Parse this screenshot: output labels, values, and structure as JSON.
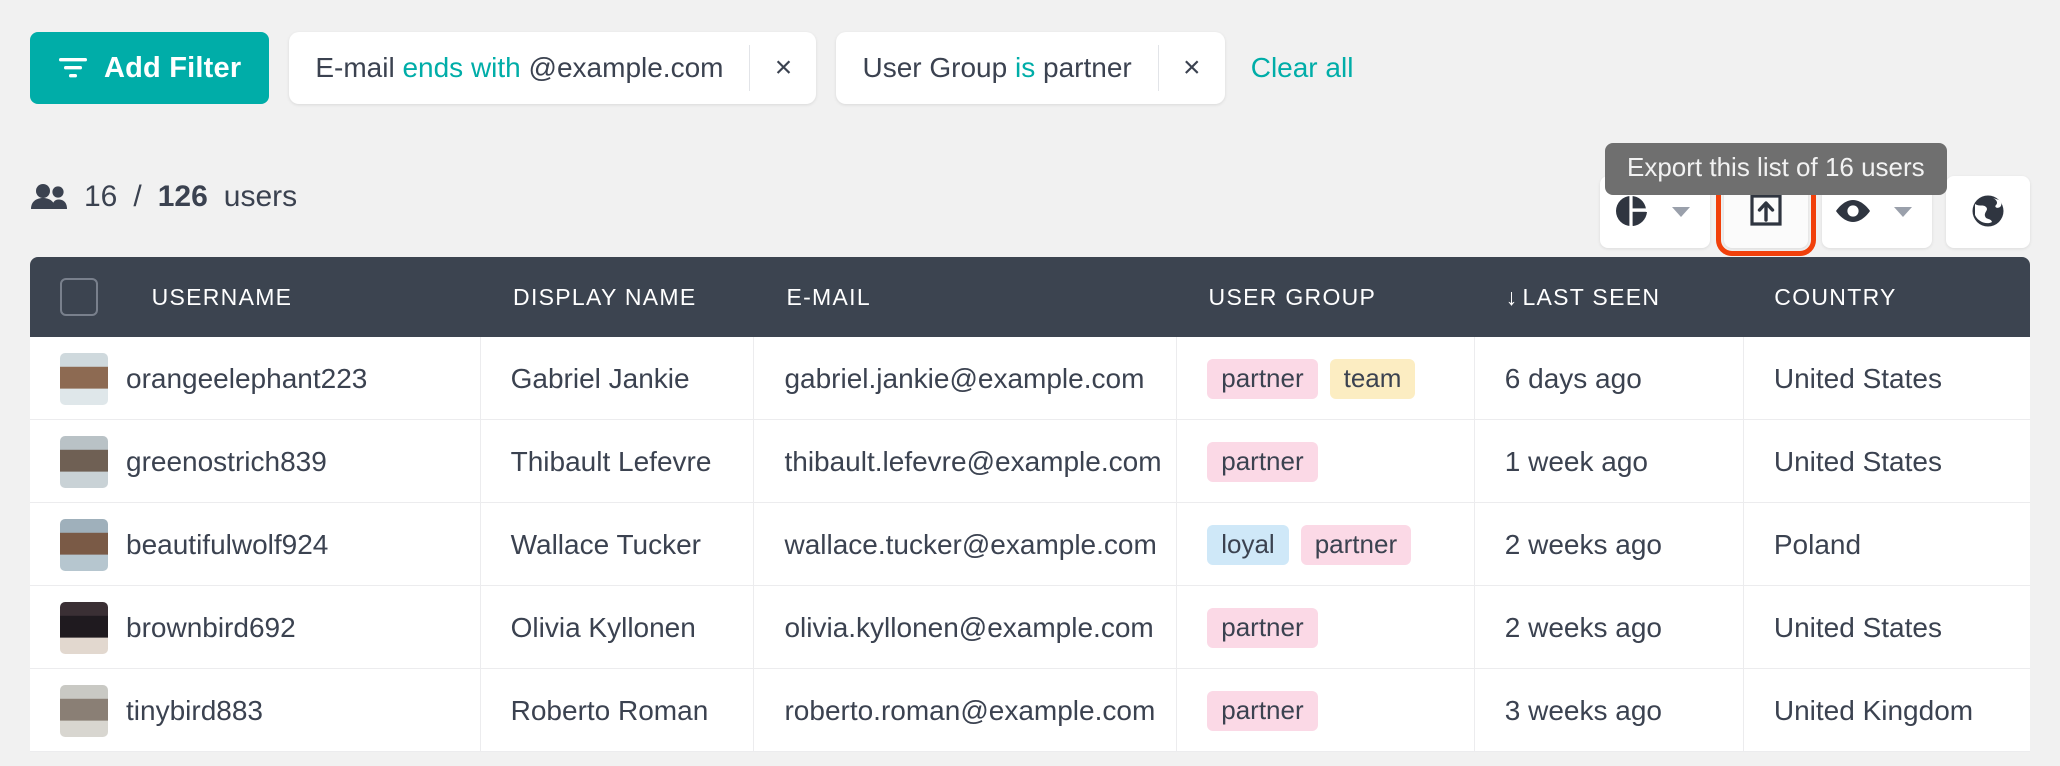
{
  "filter_bar": {
    "add_filter_label": "Add Filter",
    "clear_all_label": "Clear all",
    "close_glyph": "×",
    "chips": [
      {
        "field": "E-mail",
        "operator": "ends with",
        "value": "@example.com"
      },
      {
        "field": "User Group",
        "operator": "is",
        "value": "partner"
      }
    ]
  },
  "summary": {
    "shown": "16",
    "separator": "/",
    "total": "126",
    "unit": "users"
  },
  "toolbar": {
    "tooltip": "Export this list of 16 users",
    "buttons": [
      {
        "name": "chart-icon",
        "label": "Chart view",
        "has_caret": true
      },
      {
        "name": "export-icon",
        "label": "Export",
        "has_caret": false
      },
      {
        "name": "eye-icon",
        "label": "Visible columns",
        "has_caret": true
      },
      {
        "name": "globe-icon",
        "label": "Locale",
        "has_caret": false
      }
    ],
    "highlight_color": "#f1400b"
  },
  "table": {
    "columns": [
      {
        "key": "username",
        "label": "USERNAME",
        "sorted": false
      },
      {
        "key": "display_name",
        "label": "DISPLAY NAME",
        "sorted": false
      },
      {
        "key": "email",
        "label": "E-MAIL",
        "sorted": false
      },
      {
        "key": "user_group",
        "label": "USER GROUP",
        "sorted": false
      },
      {
        "key": "last_seen",
        "label": "LAST SEEN",
        "sorted": true,
        "sort_glyph": "↓"
      },
      {
        "key": "country",
        "label": "COUNTRY",
        "sorted": false
      }
    ],
    "rows": [
      {
        "username": "orangeelephant223",
        "display_name": "Gabriel Jankie",
        "email": "gabriel.jankie@example.com",
        "user_group": [
          "partner",
          "team"
        ],
        "last_seen": "6 days ago",
        "country": "United States"
      },
      {
        "username": "greenostrich839",
        "display_name": "Thibault Lefevre",
        "email": "thibault.lefevre@example.com",
        "user_group": [
          "partner"
        ],
        "last_seen": "1 week ago",
        "country": "United States"
      },
      {
        "username": "beautifulwolf924",
        "display_name": "Wallace Tucker",
        "email": "wallace.tucker@example.com",
        "user_group": [
          "loyal",
          "partner"
        ],
        "last_seen": "2 weeks ago",
        "country": "Poland"
      },
      {
        "username": "brownbird692",
        "display_name": "Olivia Kyllonen",
        "email": "olivia.kyllonen@example.com",
        "user_group": [
          "partner"
        ],
        "last_seen": "2 weeks ago",
        "country": "United States"
      },
      {
        "username": "tinybird883",
        "display_name": "Roberto Roman",
        "email": "roberto.roman@example.com",
        "user_group": [
          "partner"
        ],
        "last_seen": "3 weeks ago",
        "country": "United Kingdom"
      }
    ]
  },
  "colors": {
    "accent": "#00ada8",
    "header_bg": "#3c4450",
    "page_bg": "#f1f1f1",
    "tag_partner": "#fbd9e6",
    "tag_team": "#fcedc2",
    "tag_loyal": "#cfe8f8"
  }
}
